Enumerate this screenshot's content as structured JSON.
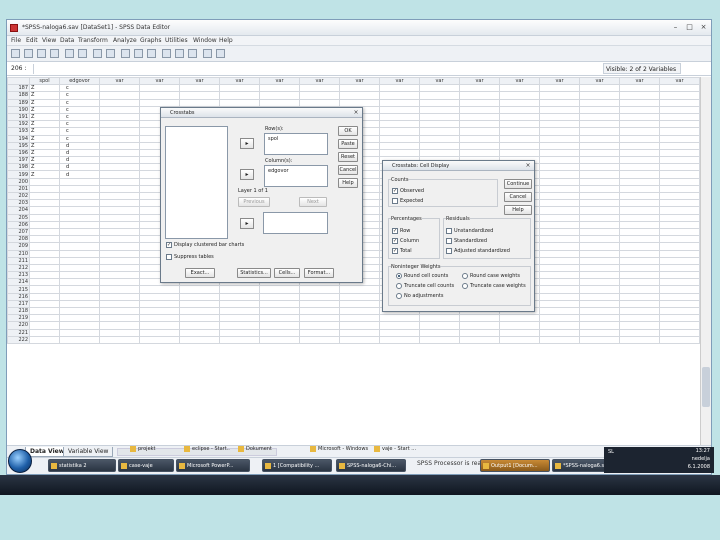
{
  "window": {
    "title": "*SPSS-naloga6.sav [DataSet1] - SPSS Data Editor"
  },
  "menu": [
    "File",
    "Edit",
    "View",
    "Data",
    "Transform",
    "Analyze",
    "Graphs",
    "Utilities",
    "Window",
    "Help"
  ],
  "cellbar": {
    "ref": "206 :",
    "visible": "Visible: 2 of 2 Variables"
  },
  "grid": {
    "columns": [
      "spol",
      "edgovor",
      "var",
      "var",
      "var",
      "var",
      "var",
      "var",
      "var",
      "var",
      "var",
      "var",
      "var",
      "var",
      "var",
      "var",
      "var"
    ],
    "rows": [
      {
        "n": "187",
        "spol": "Z",
        "edgovor": "c"
      },
      {
        "n": "188",
        "spol": "Z",
        "edgovor": "c"
      },
      {
        "n": "189",
        "spol": "Z",
        "edgovor": "c"
      },
      {
        "n": "190",
        "spol": "Z",
        "edgovor": "c"
      },
      {
        "n": "191",
        "spol": "Z",
        "edgovor": "c"
      },
      {
        "n": "192",
        "spol": "Z",
        "edgovor": "c"
      },
      {
        "n": "193",
        "spol": "Z",
        "edgovor": "c"
      },
      {
        "n": "194",
        "spol": "Z",
        "edgovor": "c"
      },
      {
        "n": "195",
        "spol": "Z",
        "edgovor": "d"
      },
      {
        "n": "196",
        "spol": "Z",
        "edgovor": "d"
      },
      {
        "n": "197",
        "spol": "Z",
        "edgovor": "d"
      },
      {
        "n": "198",
        "spol": "Z",
        "edgovor": "d"
      },
      {
        "n": "199",
        "spol": "Z",
        "edgovor": "d"
      },
      {
        "n": "200",
        "spol": "",
        "edgovor": ""
      },
      {
        "n": "201",
        "spol": "",
        "edgovor": ""
      },
      {
        "n": "202",
        "spol": "",
        "edgovor": ""
      },
      {
        "n": "203",
        "spol": "",
        "edgovor": ""
      },
      {
        "n": "204",
        "spol": "",
        "edgovor": ""
      },
      {
        "n": "205",
        "spol": "",
        "edgovor": ""
      },
      {
        "n": "206",
        "spol": "",
        "edgovor": ""
      },
      {
        "n": "207",
        "spol": "",
        "edgovor": ""
      },
      {
        "n": "208",
        "spol": "",
        "edgovor": ""
      },
      {
        "n": "209",
        "spol": "",
        "edgovor": ""
      },
      {
        "n": "210",
        "spol": "",
        "edgovor": ""
      },
      {
        "n": "211",
        "spol": "",
        "edgovor": ""
      },
      {
        "n": "212",
        "spol": "",
        "edgovor": ""
      },
      {
        "n": "213",
        "spol": "",
        "edgovor": ""
      },
      {
        "n": "214",
        "spol": "",
        "edgovor": ""
      },
      {
        "n": "215",
        "spol": "",
        "edgovor": ""
      },
      {
        "n": "216",
        "spol": "",
        "edgovor": ""
      },
      {
        "n": "217",
        "spol": "",
        "edgovor": ""
      },
      {
        "n": "218",
        "spol": "",
        "edgovor": ""
      },
      {
        "n": "219",
        "spol": "",
        "edgovor": ""
      },
      {
        "n": "220",
        "spol": "",
        "edgovor": ""
      },
      {
        "n": "221",
        "spol": "",
        "edgovor": ""
      },
      {
        "n": "222",
        "spol": "",
        "edgovor": ""
      }
    ]
  },
  "tabs": {
    "data_view": "Data View",
    "variable_view": "Variable View"
  },
  "status": "SPSS Processor is ready",
  "crosstabs": {
    "title": "Crosstabs",
    "rows_label": "Row(s):",
    "row_var": "spol",
    "columns_label": "Column(s):",
    "col_var": "edgovor",
    "layer_label": "Layer 1 of 1",
    "previous": "Previous",
    "next": "Next",
    "display_clustered": "Display clustered bar charts",
    "suppress_tables": "Suppress tables",
    "buttons": {
      "ok": "OK",
      "paste": "Paste",
      "reset": "Reset",
      "cancel": "Cancel",
      "help": "Help"
    },
    "bottom": {
      "exact": "Exact...",
      "statistics": "Statistics...",
      "cells": "Cells...",
      "format": "Format..."
    }
  },
  "cell_display": {
    "title": "Crosstabs: Cell Display",
    "counts_label": "Counts",
    "observed": "Observed",
    "expected": "Expected",
    "percentages_label": "Percentages",
    "row": "Row",
    "column": "Column",
    "total": "Total",
    "residuals_label": "Residuals",
    "unstandardized": "Unstandardized",
    "standardized": "Standardized",
    "adjusted": "Adjusted standardized",
    "noninteger_label": "Noninteger Weights",
    "round_cell": "Round cell counts",
    "round_case": "Round case weights",
    "truncate_cell": "Truncate cell counts",
    "truncate_case": "Truncate case weights",
    "no_adjust": "No adjustments",
    "buttons": {
      "continue": "Continue",
      "cancel": "Cancel",
      "help": "Help"
    }
  },
  "taskbar": {
    "items": [
      "statistika 2",
      "case-vaje",
      "Microsoft PowerP...",
      "1 [Compatibility ...",
      "SPSS-naloga6-Chi...",
      "Output1 [Docum...",
      "*SPSS-naloga6.sav..."
    ],
    "top_items": [
      "projekt",
      "eclipse - Start...",
      "Dokument",
      "Microsoft - Windows ...",
      "vaje - Start ..."
    ],
    "lang": "SL",
    "time": "13:27",
    "day": "nedelja",
    "date": "6.1.2008"
  }
}
